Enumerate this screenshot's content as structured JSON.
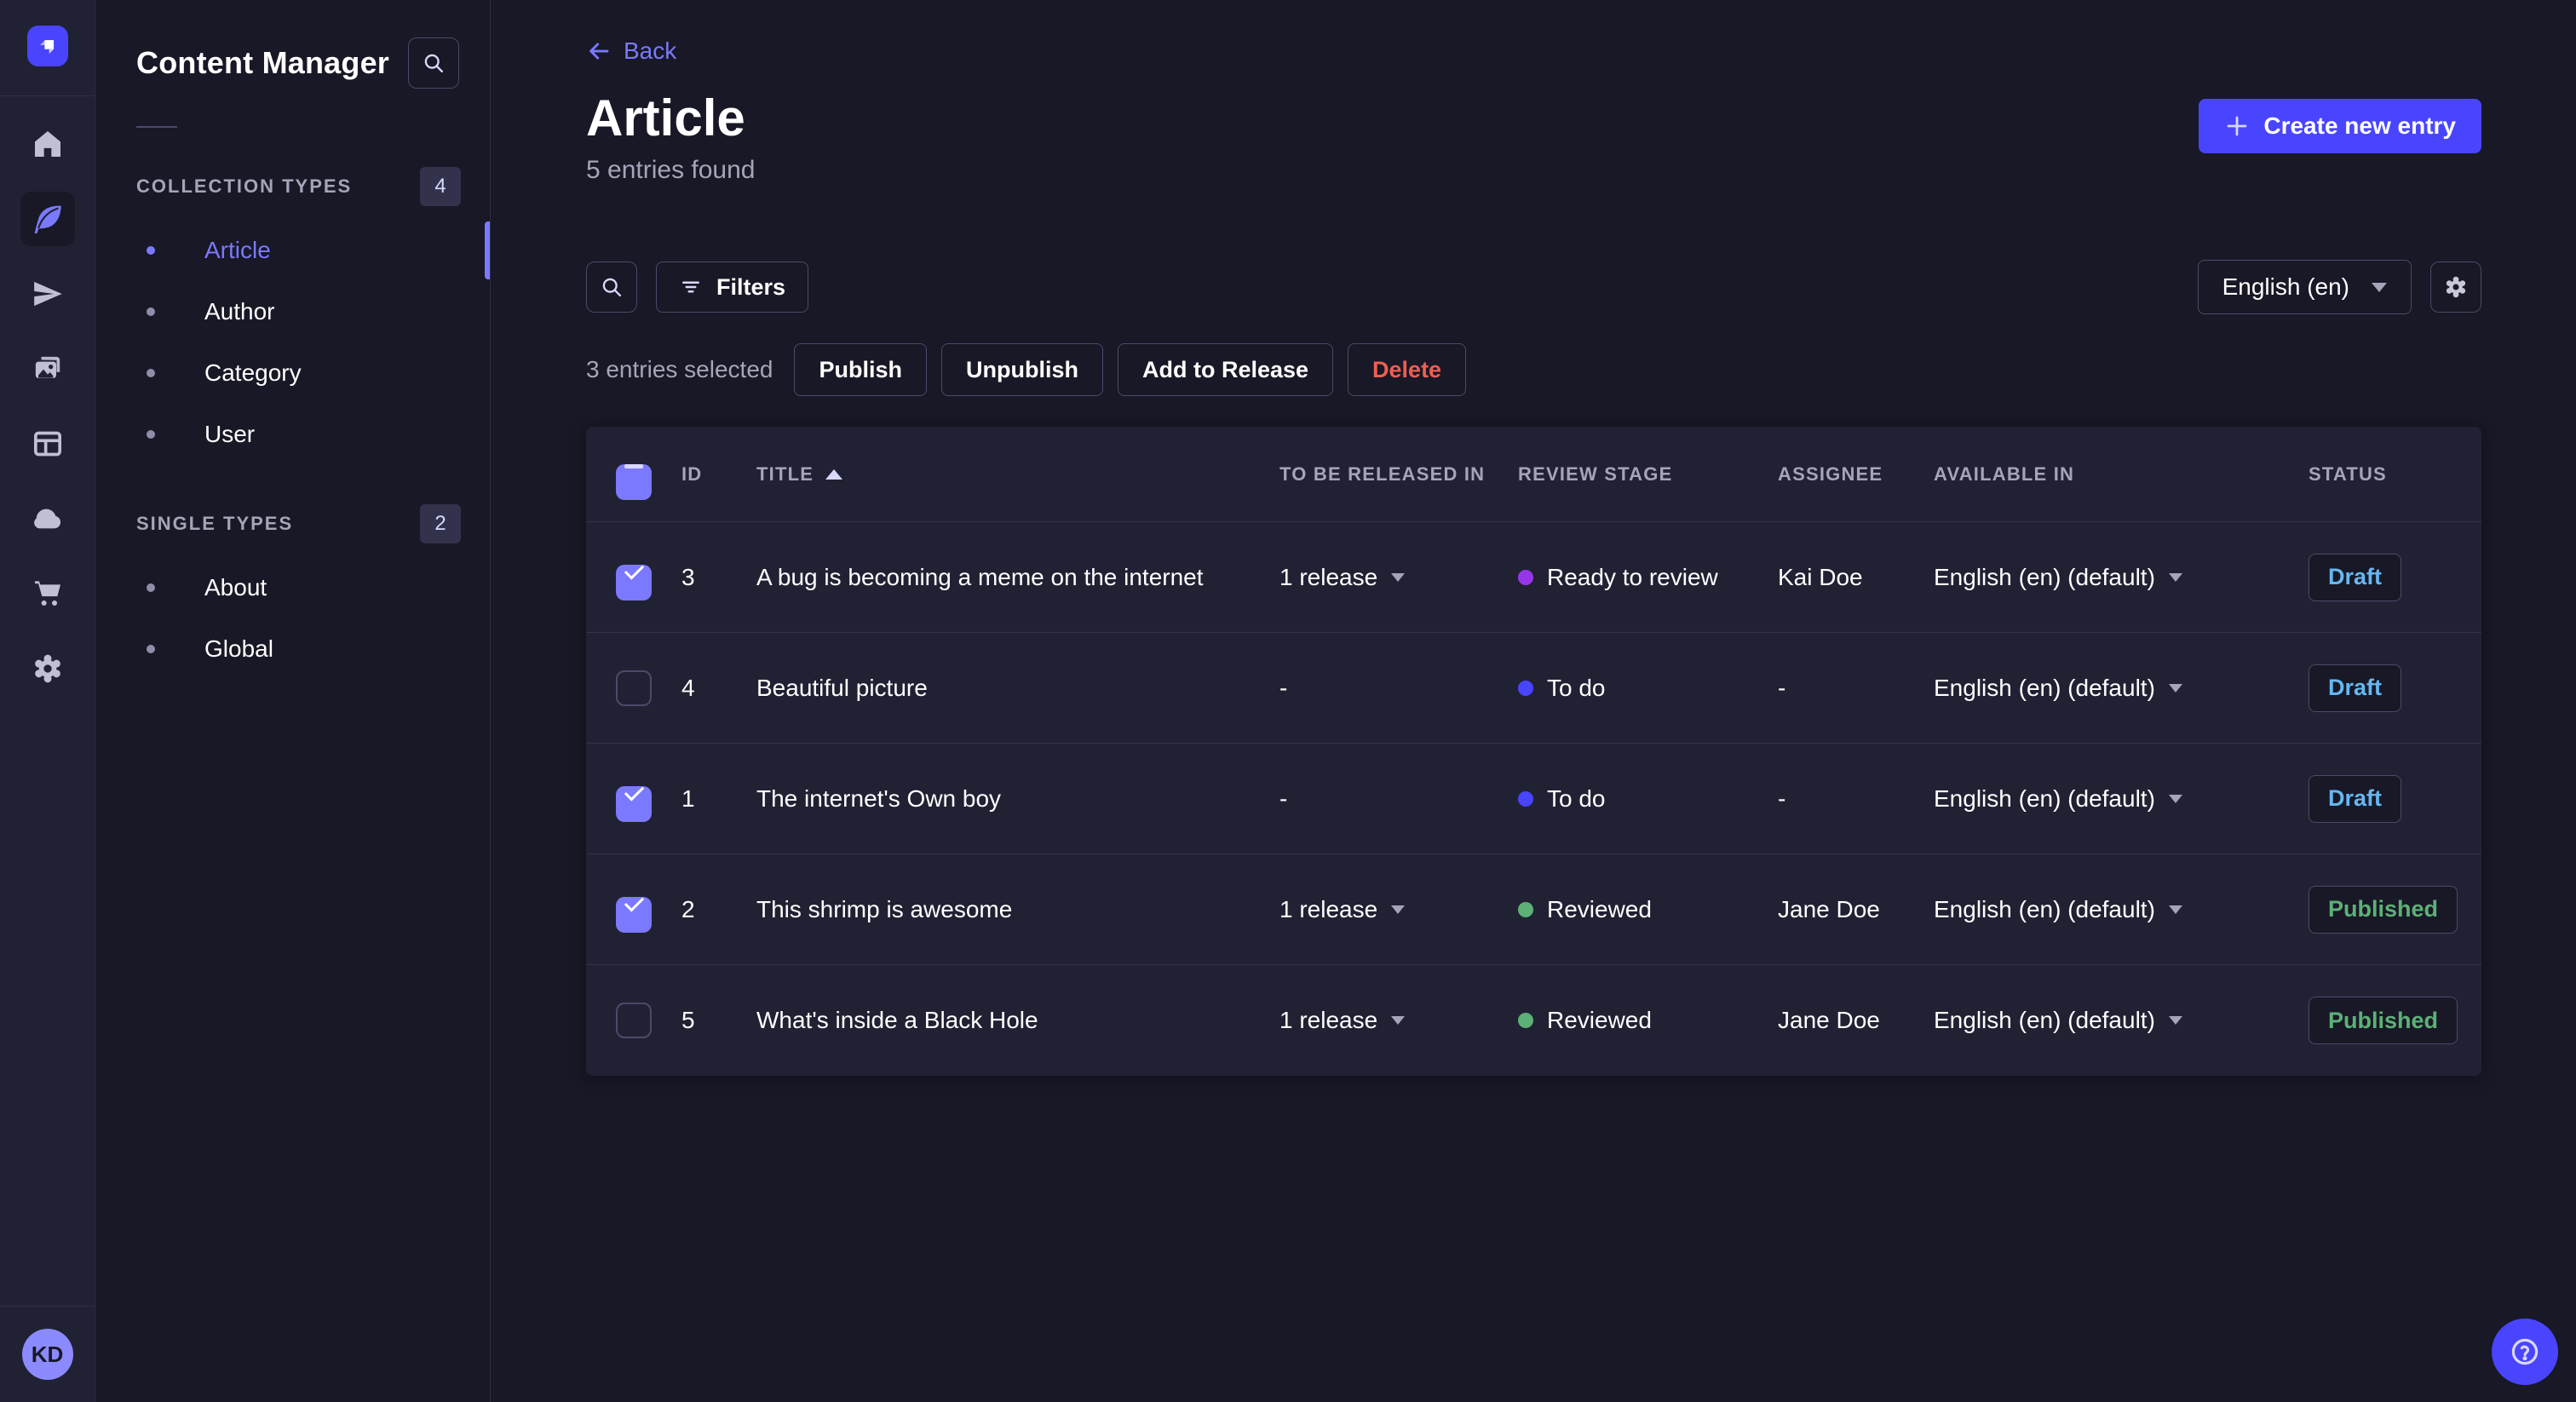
{
  "colors": {
    "primary": "#4945ff",
    "accent": "#7b79ff",
    "draft": "#66b7f1",
    "published": "#5cb176",
    "danger": "#ee5e52",
    "stage_ready": "#9736e8",
    "stage_todo": "#4945ff",
    "stage_reviewed": "#5cb176"
  },
  "primary_nav": {
    "items": [
      {
        "icon": "home-icon",
        "active": false
      },
      {
        "icon": "feather-icon",
        "active": true
      },
      {
        "icon": "paper-plane-icon",
        "active": false
      },
      {
        "icon": "media-icon",
        "active": false
      },
      {
        "icon": "layout-icon",
        "active": false
      },
      {
        "icon": "cloud-icon",
        "active": false
      },
      {
        "icon": "cart-icon",
        "active": false
      },
      {
        "icon": "gear-icon",
        "active": false
      }
    ],
    "user_initials": "KD"
  },
  "sidebar": {
    "title": "Content Manager",
    "sections": [
      {
        "label": "COLLECTION TYPES",
        "count": "4",
        "items": [
          {
            "label": "Article",
            "active": true
          },
          {
            "label": "Author",
            "active": false
          },
          {
            "label": "Category",
            "active": false
          },
          {
            "label": "User",
            "active": false
          }
        ]
      },
      {
        "label": "SINGLE TYPES",
        "count": "2",
        "items": [
          {
            "label": "About",
            "active": false
          },
          {
            "label": "Global",
            "active": false
          }
        ]
      }
    ]
  },
  "header": {
    "back_label": "Back",
    "title": "Article",
    "subtitle": "5 entries found",
    "create_button": "Create new entry"
  },
  "toolbar": {
    "filters_label": "Filters",
    "locale": "English (en)"
  },
  "selection": {
    "summary": "3 entries selected",
    "publish": "Publish",
    "unpublish": "Unpublish",
    "add_to_release": "Add to Release",
    "delete": "Delete"
  },
  "table": {
    "columns": {
      "id": "ID",
      "title": "TITLE",
      "release": "TO BE RELEASED IN",
      "stage": "REVIEW STAGE",
      "assignee": "ASSIGNEE",
      "available": "AVAILABLE IN",
      "status": "STATUS"
    },
    "rows": [
      {
        "selected": true,
        "id": "3",
        "title": "A bug is becoming a meme on the internet",
        "release": "1 release",
        "stage": "Ready to review",
        "stage_color": "#9736e8",
        "assignee": "Kai Doe",
        "available": "English (en) (default)",
        "status": "Draft",
        "status_color": "#66b7f1"
      },
      {
        "selected": false,
        "id": "4",
        "title": "Beautiful picture",
        "release": "-",
        "stage": "To do",
        "stage_color": "#4945ff",
        "assignee": "-",
        "available": "English (en) (default)",
        "status": "Draft",
        "status_color": "#66b7f1"
      },
      {
        "selected": true,
        "id": "1",
        "title": "The internet's Own boy",
        "release": "-",
        "stage": "To do",
        "stage_color": "#4945ff",
        "assignee": "-",
        "available": "English (en) (default)",
        "status": "Draft",
        "status_color": "#66b7f1"
      },
      {
        "selected": true,
        "id": "2",
        "title": "This shrimp is awesome",
        "release": "1 release",
        "stage": "Reviewed",
        "stage_color": "#5cb176",
        "assignee": "Jane Doe",
        "available": "English (en) (default)",
        "status": "Published",
        "status_color": "#5cb176"
      },
      {
        "selected": false,
        "id": "5",
        "title": "What's inside a Black Hole",
        "release": "1 release",
        "stage": "Reviewed",
        "stage_color": "#5cb176",
        "assignee": "Jane Doe",
        "available": "English (en) (default)",
        "status": "Published",
        "status_color": "#5cb176"
      }
    ]
  },
  "user": {
    "initials": "KD"
  }
}
